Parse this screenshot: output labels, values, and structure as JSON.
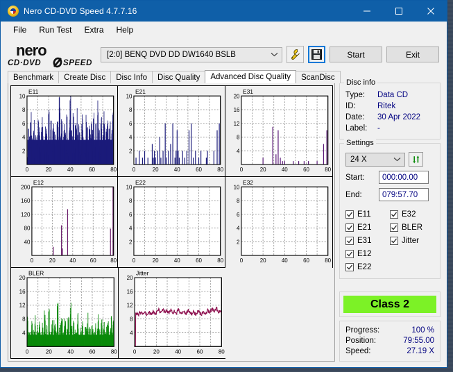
{
  "window": {
    "title": "Nero CD-DVD Speed 4.7.7.16",
    "icon": "nero-disc-icon",
    "minimize_label": "minimize-icon",
    "maximize_label": "maximize-icon",
    "close_label": "close-icon"
  },
  "menu": {
    "items": [
      "File",
      "Run Test",
      "Extra",
      "Help"
    ]
  },
  "toolbar": {
    "logo_line1": "nero",
    "logo_line2": "CD·DVD SPEED",
    "drive": "[2:0]   BENQ DVD DD DW1640 BSLB",
    "tools_icon": "wrench-icon",
    "save_icon": "floppy-disk-icon",
    "start_label": "Start",
    "exit_label": "Exit"
  },
  "tabs": [
    {
      "label": "Benchmark",
      "active": false
    },
    {
      "label": "Create Disc",
      "active": false
    },
    {
      "label": "Disc Info",
      "active": false
    },
    {
      "label": "Disc Quality",
      "active": false
    },
    {
      "label": "Advanced Disc Quality",
      "active": true
    },
    {
      "label": "ScanDisc",
      "active": false
    }
  ],
  "disc_info": {
    "legend": "Disc info",
    "rows": [
      {
        "key": "Type:",
        "value": "Data CD"
      },
      {
        "key": "ID:",
        "value": "Ritek"
      },
      {
        "key": "Date:",
        "value": "30 Apr 2022"
      },
      {
        "key": "Label:",
        "value": "-"
      }
    ]
  },
  "settings": {
    "legend": "Settings",
    "speed": "24 X",
    "refresh_icon": "refresh-arrows-icon",
    "start_label": "Start:",
    "start_value": "000:00.00",
    "end_label": "End:",
    "end_value": "079:57.70",
    "checkboxes_left": [
      {
        "label": "E11",
        "checked": true
      },
      {
        "label": "E21",
        "checked": true
      },
      {
        "label": "E31",
        "checked": true
      },
      {
        "label": "E12",
        "checked": true
      },
      {
        "label": "E22",
        "checked": true
      }
    ],
    "checkboxes_right": [
      {
        "label": "E32",
        "checked": true
      },
      {
        "label": "BLER",
        "checked": true
      },
      {
        "label": "Jitter",
        "checked": true
      }
    ]
  },
  "quality": {
    "class_label": "Class 2",
    "class_color": "#7cf226"
  },
  "status": {
    "rows": [
      {
        "key": "Progress:",
        "value": "100 %"
      },
      {
        "key": "Position:",
        "value": "79:55.00"
      },
      {
        "key": "Speed:",
        "value": "27.19 X"
      }
    ]
  },
  "chart_data": [
    {
      "type": "bar",
      "title": "E11",
      "xlabel": "",
      "ylabel": "",
      "xlim": [
        0,
        80
      ],
      "ylim": [
        0,
        10
      ],
      "xticks": [
        0,
        20,
        40,
        60,
        80
      ],
      "yticks": [
        2,
        4,
        6,
        8,
        10
      ],
      "grid": true,
      "color": "#1b1b7a",
      "fill": true,
      "description": "Dense solid band of E11 errors filling 0-4 with frequent spikes to 6-10 across the whole 0-80 min span",
      "baseline": 3.6,
      "values": [
        1.0,
        5.0,
        6.0,
        8.0,
        4.0,
        3.0,
        6.0,
        2.0,
        5.0,
        4.0,
        8.0,
        6.0,
        3.0,
        5.0,
        7.0,
        4.0,
        2.0,
        6.0,
        5.0,
        3.0,
        8.0,
        4.0,
        6.0,
        3.0,
        5.0,
        7.0,
        4.0,
        2.0,
        6.0,
        5.0,
        9.0,
        4.0,
        8.0,
        3.0,
        6.0,
        5.0,
        4.0,
        7.0,
        3.0,
        6.0,
        10.0,
        5.0,
        4.0,
        8.0,
        3.0,
        6.0,
        9.0,
        4.0,
        7.0,
        5.0,
        3.0,
        8.0,
        6.0,
        4.0,
        2.0,
        7.0,
        5.0,
        3.0,
        6.0,
        4.0,
        8.0,
        5.0,
        7.0,
        3.0,
        6.0,
        4.0,
        9.0,
        5.0,
        3.0,
        7.0,
        4.0,
        6.0,
        8.0,
        3.0,
        5.0,
        7.0,
        4.0,
        6.0,
        3.0,
        5.0,
        7.0
      ]
    },
    {
      "type": "bar",
      "title": "E21",
      "xlabel": "",
      "ylabel": "",
      "xlim": [
        0,
        80
      ],
      "ylim": [
        0,
        10
      ],
      "xticks": [
        0,
        20,
        40,
        60,
        80
      ],
      "yticks": [
        2,
        4,
        6,
        8,
        10
      ],
      "grid": true,
      "color": "#1b1b7a",
      "fill": false,
      "description": "Sparse isolated E21 spikes, mostly 1-2 with a few reaching 4-6",
      "points": [
        [
          2,
          1
        ],
        [
          5,
          2
        ],
        [
          8,
          1
        ],
        [
          10,
          2
        ],
        [
          13,
          1
        ],
        [
          17,
          3
        ],
        [
          18,
          1
        ],
        [
          19,
          2
        ],
        [
          20,
          1
        ],
        [
          22,
          2
        ],
        [
          24,
          4
        ],
        [
          25,
          1
        ],
        [
          27,
          2
        ],
        [
          29,
          6
        ],
        [
          30,
          1
        ],
        [
          32,
          2
        ],
        [
          34,
          3
        ],
        [
          36,
          6
        ],
        [
          38,
          1
        ],
        [
          39,
          2
        ],
        [
          40,
          5
        ],
        [
          41,
          2
        ],
        [
          42,
          1
        ],
        [
          45,
          2
        ],
        [
          47,
          1
        ],
        [
          49,
          2
        ],
        [
          51,
          5
        ],
        [
          53,
          6
        ],
        [
          55,
          1
        ],
        [
          57,
          2
        ],
        [
          60,
          1
        ],
        [
          62,
          2
        ],
        [
          67,
          1
        ],
        [
          68,
          2
        ],
        [
          74,
          2
        ],
        [
          77,
          5
        ],
        [
          79,
          6
        ]
      ]
    },
    {
      "type": "bar",
      "title": "E31",
      "xlabel": "",
      "ylabel": "",
      "xlim": [
        0,
        80
      ],
      "ylim": [
        0,
        20
      ],
      "xticks": [
        0,
        20,
        40,
        60,
        80
      ],
      "yticks": [
        4,
        8,
        12,
        16,
        20
      ],
      "grid": true,
      "color": "#5a1878",
      "fill": false,
      "description": "Very sparse E31 spikes; two tall ones near 29 (11) and 34 (10), plus small ticks",
      "points": [
        [
          20,
          2
        ],
        [
          29,
          11
        ],
        [
          32,
          3
        ],
        [
          34,
          10
        ],
        [
          36,
          2
        ],
        [
          38,
          1
        ],
        [
          40,
          1
        ],
        [
          48,
          1
        ],
        [
          53,
          1
        ],
        [
          58,
          1
        ],
        [
          62,
          1
        ],
        [
          70,
          1
        ],
        [
          76,
          6
        ],
        [
          79,
          10
        ]
      ]
    },
    {
      "type": "bar",
      "title": "E12",
      "xlabel": "",
      "ylabel": "",
      "xlim": [
        0,
        80
      ],
      "ylim": [
        0,
        200
      ],
      "xticks": [
        0,
        20,
        40,
        60,
        80
      ],
      "yticks": [
        40,
        80,
        120,
        160,
        200
      ],
      "grid": true,
      "color": "#6b1d6b",
      "fill": false,
      "description": "Few E12 spikes: ~25 at 21, ~88 at 29, ~135 at 35, ~78 at 77, ~200 at 80",
      "points": [
        [
          21,
          25
        ],
        [
          29,
          88
        ],
        [
          30,
          20
        ],
        [
          35,
          135
        ],
        [
          77,
          78
        ],
        [
          80,
          200
        ]
      ]
    },
    {
      "type": "bar",
      "title": "E22",
      "xlabel": "",
      "ylabel": "",
      "xlim": [
        0,
        80
      ],
      "ylim": [
        0,
        10
      ],
      "xticks": [
        0,
        20,
        40,
        60,
        80
      ],
      "yticks": [
        2,
        4,
        6,
        8,
        10
      ],
      "grid": true,
      "color": "#1b1b7a",
      "fill": false,
      "description": "No E22 errors recorded — empty plot",
      "points": []
    },
    {
      "type": "bar",
      "title": "E32",
      "xlabel": "",
      "ylabel": "",
      "xlim": [
        0,
        80
      ],
      "ylim": [
        0,
        10
      ],
      "xticks": [
        0,
        20,
        40,
        60,
        80
      ],
      "yticks": [
        2,
        4,
        6,
        8,
        10
      ],
      "grid": true,
      "color": "#1b1b7a",
      "fill": false,
      "description": "No E32 errors recorded — empty plot",
      "points": []
    },
    {
      "type": "bar",
      "title": "BLER",
      "xlabel": "",
      "ylabel": "",
      "xlim": [
        0,
        80
      ],
      "ylim": [
        0,
        20
      ],
      "xticks": [
        0,
        20,
        40,
        60,
        80
      ],
      "yticks": [
        4,
        8,
        12,
        16,
        20
      ],
      "grid": true,
      "color": "#0a8a0a",
      "fill": true,
      "description": "Dense green BLER band filling 0-4 with constant spikes to 6-12 across 0-80 min",
      "baseline": 3.4,
      "values": [
        8.0,
        4.0,
        6.0,
        3.0,
        7.0,
        5.0,
        4.0,
        9.0,
        3.0,
        6.0,
        5.0,
        8.0,
        4.0,
        3.0,
        7.0,
        5.0,
        10.0,
        4.0,
        6.0,
        3.0,
        11.0,
        5.0,
        4.0,
        8.0,
        3.0,
        9.0,
        6.0,
        4.0,
        12.0,
        5.0,
        3.0,
        7.0,
        10.0,
        4.0,
        6.0,
        8.0,
        3.0,
        5.0,
        11.0,
        4.0,
        12.0,
        6.0,
        3.0,
        8.0,
        5.0,
        4.0,
        7.0,
        9.0,
        3.0,
        6.0,
        5.0,
        8.0,
        4.0,
        3.0,
        7.0,
        5.0,
        9.0,
        4.0,
        6.0,
        3.0,
        8.0,
        5.0,
        4.0,
        7.0,
        3.0,
        6.0,
        9.0,
        5.0,
        4.0,
        8.0,
        3.0,
        7.0,
        5.0,
        4.0,
        6.0,
        8.0,
        3.0,
        5.0,
        11.0,
        4.0,
        7.0
      ]
    },
    {
      "type": "line",
      "title": "Jitter",
      "xlabel": "",
      "ylabel": "",
      "xlim": [
        0,
        80
      ],
      "ylim": [
        0,
        20
      ],
      "xticks": [
        0,
        20,
        40,
        60,
        80
      ],
      "yticks": [
        4,
        8,
        12,
        16,
        20
      ],
      "grid": true,
      "color": "#8e1250",
      "fill": false,
      "description": "Noisy jitter trace hovering between 9 and 11 percent for the whole scan",
      "values": [
        0.0,
        9.4,
        9.6,
        9.3,
        9.7,
        9.5,
        9.8,
        9.4,
        9.6,
        9.9,
        9.5,
        9.3,
        9.7,
        10.0,
        9.6,
        9.4,
        9.8,
        10.2,
        9.7,
        9.5,
        9.9,
        10.4,
        10.8,
        10.1,
        9.8,
        10.3,
        11.0,
        10.2,
        9.9,
        10.5,
        10.0,
        9.7,
        10.1,
        10.6,
        10.2,
        9.8,
        10.4,
        10.0,
        9.6,
        10.2,
        10.7,
        10.1,
        9.8,
        9.5,
        9.9,
        10.3,
        9.7,
        9.4,
        10.0,
        10.5,
        10.1,
        9.6,
        9.3,
        9.8,
        10.2,
        9.7,
        9.4,
        9.9,
        10.4,
        10.0,
        9.6,
        9.2,
        9.7,
        10.1,
        9.8,
        9.5,
        10.0,
        10.6,
        10.2,
        9.9,
        10.4,
        10.9,
        10.5,
        10.1,
        10.6,
        11.0,
        10.4,
        10.0,
        10.5,
        10.2,
        10.6
      ]
    }
  ]
}
